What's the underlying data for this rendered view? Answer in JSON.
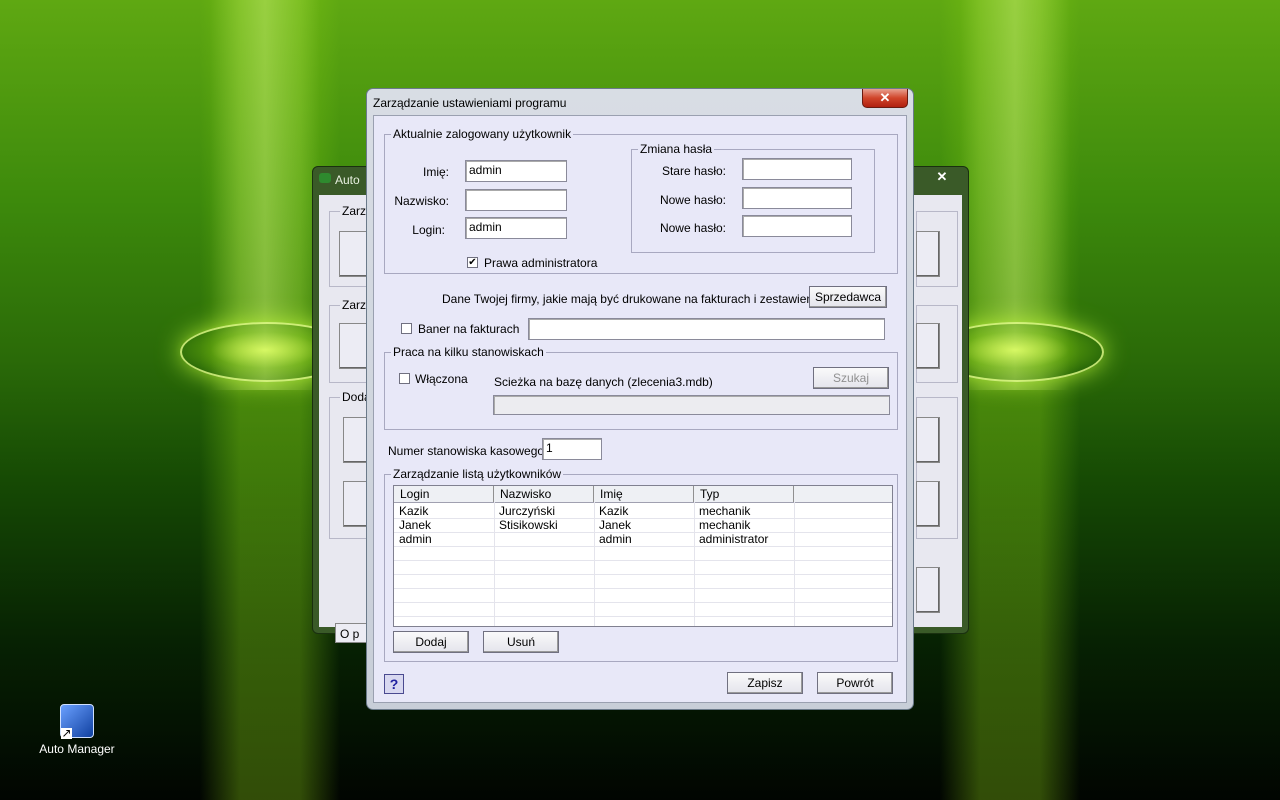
{
  "desktop": {
    "icon_label": "Auto Manager"
  },
  "back_window": {
    "title": "Auto",
    "close_glyph": "✕",
    "group1_label": "Zarzą",
    "group2_label": "Zarzą",
    "group3_label": "Doda",
    "bottom_button": "O p"
  },
  "dialog": {
    "title": "Zarządzanie ustawieniami programu",
    "close_glyph": "✕",
    "current_user": {
      "group_label": "Aktualnie zalogowany użytkownik",
      "first_name_label": "Imię:",
      "first_name_value": "admin",
      "last_name_label": "Nazwisko:",
      "last_name_value": "",
      "login_label": "Login:",
      "login_value": "admin",
      "admin_rights_label": "Prawa administratora",
      "admin_rights_checked": "✔"
    },
    "password_change": {
      "group_label": "Zmiana hasła",
      "old_label": "Stare hasło:",
      "new_label": "Nowe hasło:",
      "new2_label": "Nowe hasło:"
    },
    "company": {
      "prompt": "Dane Twojej firmy, jakie mają być drukowane na fakturach i zestawieniach:",
      "seller_button": "Sprzedawca",
      "banner_label": "Baner na fakturach",
      "banner_value": ""
    },
    "multi_station": {
      "group_label": "Praca na kilku stanowiskach",
      "enabled_label": "Włączona",
      "db_path_label": "Scieżka na bazę danych (zlecenia3.mdb)",
      "search_button": "Szukaj",
      "db_path_value": ""
    },
    "cash_station": {
      "label": "Numer stanowiska kasowego:",
      "value": "1"
    },
    "users": {
      "group_label": "Zarządzanie listą użytkowników",
      "columns": [
        "Login",
        "Nazwisko",
        "Imię",
        "Typ"
      ],
      "rows": [
        {
          "login": "Kazik",
          "last_name": "Jurczyński",
          "first_name": "Kazik",
          "type": "mechanik"
        },
        {
          "login": "Janek",
          "last_name": "Stisikowski",
          "first_name": "Janek",
          "type": "mechanik"
        },
        {
          "login": "admin",
          "last_name": "",
          "first_name": "admin",
          "type": "administrator"
        }
      ],
      "add_button": "Dodaj",
      "remove_button": "Usuń"
    },
    "help_glyph": "?",
    "save_button": "Zapisz",
    "back_button": "Powrót"
  }
}
